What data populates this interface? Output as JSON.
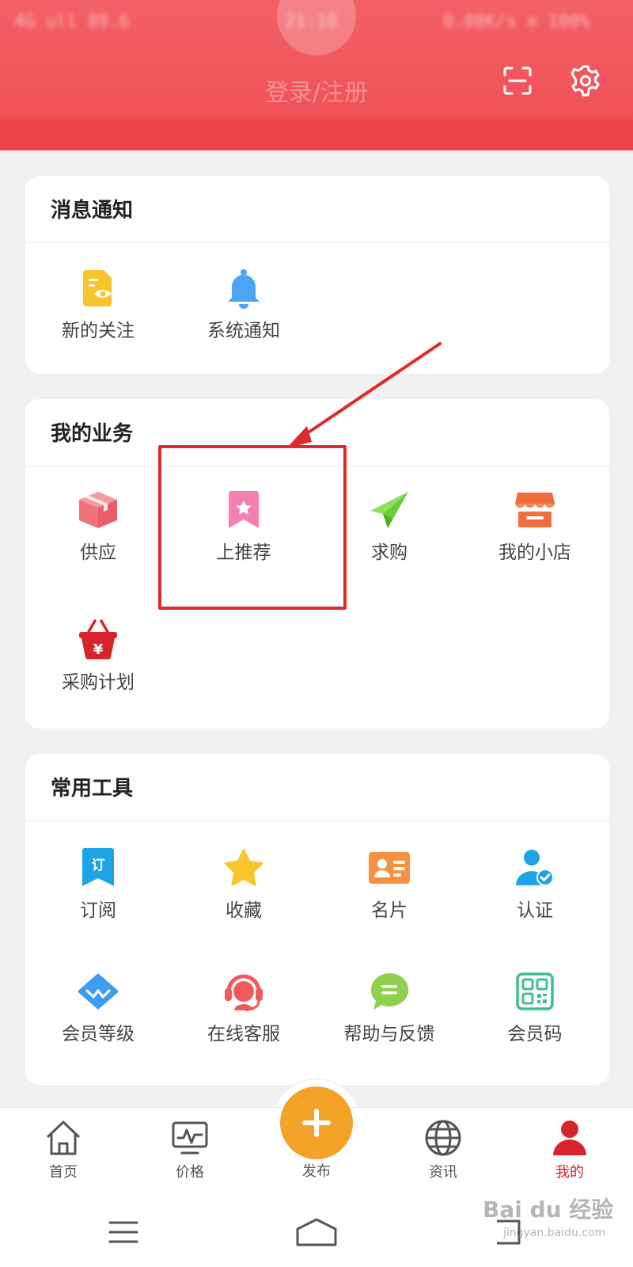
{
  "status_bar": {
    "left": "4G ull 89.6",
    "center": "21:18",
    "right": "0.08K/s ≋ 100%"
  },
  "header": {
    "login_label": "登录/注册",
    "scan_icon": "scan-icon",
    "settings_icon": "gear-icon"
  },
  "messages": {
    "title": "消息通知",
    "items": [
      {
        "label": "新的关注",
        "icon": "follow-eye-icon",
        "color": "#f7c52b"
      },
      {
        "label": "系统通知",
        "icon": "bell-icon",
        "color": "#4aa6f4"
      }
    ]
  },
  "business": {
    "title": "我的业务",
    "items": [
      {
        "label": "供应",
        "icon": "box-icon",
        "color": "#f0727d"
      },
      {
        "label": "上推荐",
        "icon": "bookmark-star-icon",
        "color": "#f57fb1"
      },
      {
        "label": "求购",
        "icon": "paper-plane-icon",
        "color": "#6dcc3e"
      },
      {
        "label": "我的小店",
        "icon": "shop-icon",
        "color": "#f26d3e"
      },
      {
        "label": "采购计划",
        "icon": "yuan-basket-icon",
        "color": "#d8232a"
      }
    ]
  },
  "tools": {
    "title": "常用工具",
    "items": [
      {
        "label": "订阅",
        "icon": "subscribe-icon",
        "color": "#1ea3e8",
        "glyph": "订"
      },
      {
        "label": "收藏",
        "icon": "star-icon",
        "color": "#f9c52a"
      },
      {
        "label": "名片",
        "icon": "card-icon",
        "color": "#f6923f"
      },
      {
        "label": "认证",
        "icon": "verified-user-icon",
        "color": "#1ea3e8"
      },
      {
        "label": "会员等级",
        "icon": "diamond-icon",
        "color": "#3e9bf4"
      },
      {
        "label": "在线客服",
        "icon": "headset-icon",
        "color": "#f05a5a"
      },
      {
        "label": "帮助与反馈",
        "icon": "chat-bubble-icon",
        "color": "#8fd04d"
      },
      {
        "label": "会员码",
        "icon": "qr-code-icon",
        "color": "#3ebf8c"
      }
    ]
  },
  "bottom_nav": {
    "items": [
      {
        "label": "首页",
        "icon": "home-icon"
      },
      {
        "label": "价格",
        "icon": "price-chart-icon"
      },
      {
        "label": "发布",
        "icon": "plus-icon"
      },
      {
        "label": "资讯",
        "icon": "globe-icon"
      },
      {
        "label": "我的",
        "icon": "user-icon",
        "active": true
      }
    ]
  },
  "watermark": {
    "main": "Bai du 经验",
    "sub": "jingyan.baidu.com"
  },
  "colors": {
    "header": "#f05258",
    "accent": "#d8232a",
    "publish": "#f5a228",
    "annotation": "#e02a2a"
  }
}
